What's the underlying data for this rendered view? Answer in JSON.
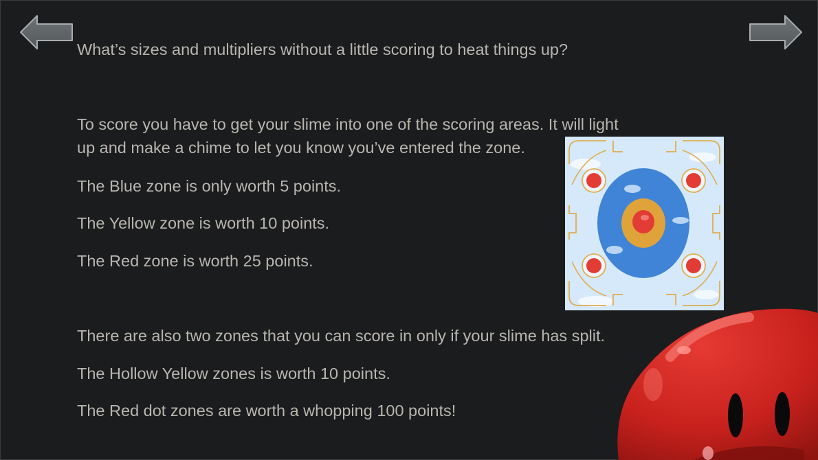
{
  "navigation": {
    "prev_icon": "arrow-left-icon",
    "next_icon": "arrow-right-icon"
  },
  "slide": {
    "intro": "What’s sizes and multipliers without a little scoring to heat things up?",
    "scoring_line_1": "To score you have to get your slime into one of the scoring areas. It will light",
    "scoring_line_2": "up and make a chime to let you know you’ve entered the zone.",
    "blue_zone": "The Blue zone is only worth 5 points.",
    "yellow_zone": "The Yellow zone is worth 10 points.",
    "red_zone": "The Red zone is worth 25 points.",
    "split_intro": "There are also two zones that you can score in only if your slime has split.",
    "hollow_yellow": "The Hollow Yellow zones is worth 10 points.",
    "red_dot": "The Red dot zones are worth a whopping 100 points!"
  },
  "colors": {
    "background": "#1b1c1e",
    "text": "#b9b6b0",
    "blue_zone": "#3f84d6",
    "yellow_zone": "#e0a33a",
    "red_zone": "#e33c34",
    "slime": "#c8211d"
  },
  "images": {
    "board": "scoring-board-illustration",
    "mascot": "red-slime-mascot"
  }
}
